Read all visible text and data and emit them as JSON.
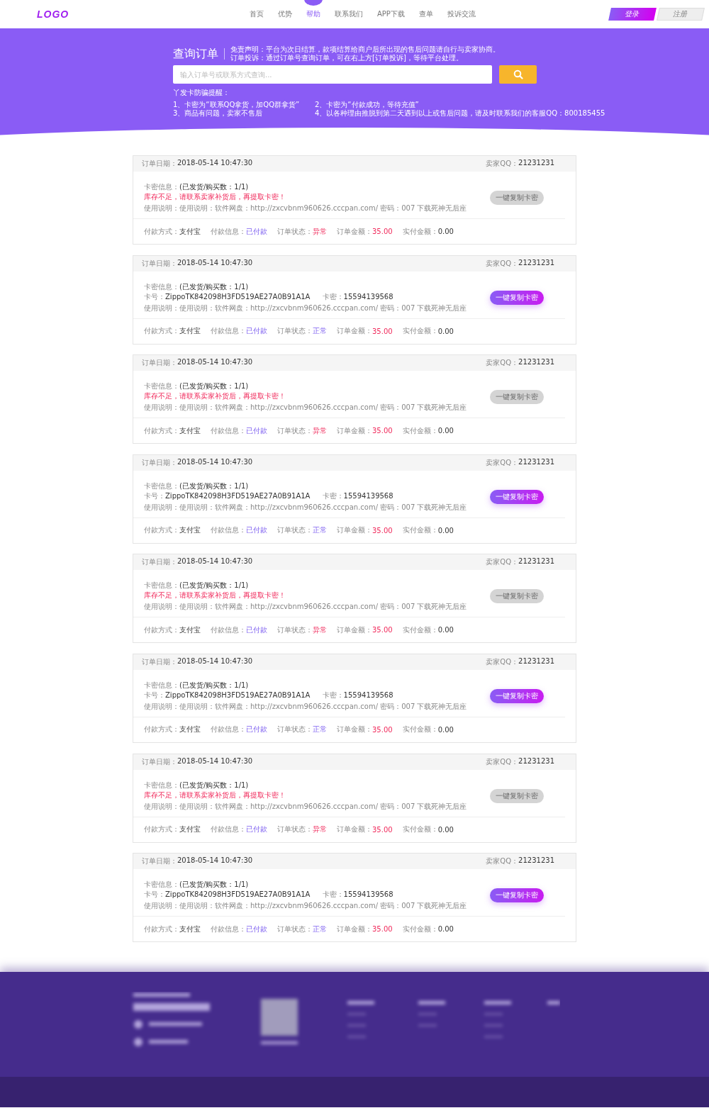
{
  "header": {
    "logo": "LOGO",
    "nav": [
      {
        "label": "首页",
        "selected": false
      },
      {
        "label": "优势",
        "selected": false
      },
      {
        "label": "帮助",
        "selected": true
      },
      {
        "label": "联系我们",
        "selected": false
      },
      {
        "label": "APP下载",
        "selected": false
      },
      {
        "label": "查单",
        "selected": false
      },
      {
        "label": "投诉交流",
        "selected": false
      }
    ],
    "login": "登录",
    "register": "注册"
  },
  "search": {
    "title": "查询订单",
    "notes": [
      "免责声明：平台为次日结算，款项结算给商户后所出现的售后问题请自行与卖家协商。",
      "订单投诉：通过订单号查询订单，可在右上方[订单投诉]，等待平台处理。"
    ],
    "placeholder": "输入订单号或联系方式查询...",
    "warning_title": "丫发卡防骗提醒：",
    "tips": [
      "1、卡密为“联系QQ拿货，加QQ群拿货”",
      "2、卡密为“付款成功，等待充值”",
      "3、商品有问题，卖家不售后",
      "4、以各种理由推脱到第二天遇到以上或售后问题，请及时联系我们的客服QQ：800185455"
    ]
  },
  "orders": [
    {
      "kind": "out_of_stock",
      "date_label": "订单日期：",
      "date": "2018-05-14 10:47:30",
      "qq_label": "卖家QQ：",
      "qq": "21231231",
      "info_label": "卡密信息：",
      "info": "(已发货/购买数：1/1)",
      "message": "库存不足，请联系卖家补货后，再提取卡密！",
      "usage_label": "使用说明：",
      "usage": "使用说明：软件网盘：http://zxcvbnm960626.cccpan.com/ 密码：007 下载死神无后座",
      "copy": {
        "label": "一键复制卡密",
        "disabled": true
      },
      "pay_label": "付款方式：",
      "pay": "支付宝",
      "payinfo_label": "付款信息：",
      "payinfo": "已付款",
      "status_label": "订单状态：",
      "status": "异常",
      "status_ok": false,
      "amount_label": "订单金额：",
      "amount": "35.00",
      "paid_label": "实付金额：",
      "paid": "0.00"
    },
    {
      "kind": "delivered",
      "date_label": "订单日期：",
      "date": "2018-05-14 10:47:30",
      "qq_label": "卖家QQ：",
      "qq": "21231231",
      "info_label": "卡密信息：",
      "info": "(已发货/购买数：1/1)",
      "card_no_label": "卡号：",
      "card_no": "ZippoTK842098H3FD519AE27A0B91A1A",
      "card_pw_label": "卡密：",
      "card_pw": "15594139568",
      "usage_label": "使用说明：",
      "usage": "使用说明：软件网盘：http://zxcvbnm960626.cccpan.com/ 密码：007 下载死神无后座",
      "copy": {
        "label": "一键复制卡密",
        "disabled": false
      },
      "pay_label": "付款方式：",
      "pay": "支付宝",
      "payinfo_label": "付款信息：",
      "payinfo": "已付款",
      "status_label": "订单状态：",
      "status": "正常",
      "status_ok": true,
      "amount_label": "订单金额：",
      "amount": "35.00",
      "paid_label": "实付金额：",
      "paid": "0.00"
    },
    {
      "kind": "out_of_stock",
      "date_label": "订单日期：",
      "date": "2018-05-14 10:47:30",
      "qq_label": "卖家QQ：",
      "qq": "21231231",
      "info_label": "卡密信息：",
      "info": "(已发货/购买数：1/1)",
      "message": "库存不足，请联系卖家补货后，再提取卡密！",
      "usage_label": "使用说明：",
      "usage": "使用说明：软件网盘：http://zxcvbnm960626.cccpan.com/ 密码：007 下载死神无后座",
      "copy": {
        "label": "一键复制卡密",
        "disabled": true
      },
      "pay_label": "付款方式：",
      "pay": "支付宝",
      "payinfo_label": "付款信息：",
      "payinfo": "已付款",
      "status_label": "订单状态：",
      "status": "异常",
      "status_ok": false,
      "amount_label": "订单金额：",
      "amount": "35.00",
      "paid_label": "实付金额：",
      "paid": "0.00"
    },
    {
      "kind": "delivered",
      "date_label": "订单日期：",
      "date": "2018-05-14 10:47:30",
      "qq_label": "卖家QQ：",
      "qq": "21231231",
      "info_label": "卡密信息：",
      "info": "(已发货/购买数：1/1)",
      "card_no_label": "卡号：",
      "card_no": "ZippoTK842098H3FD519AE27A0B91A1A",
      "card_pw_label": "卡密：",
      "card_pw": "15594139568",
      "usage_label": "使用说明：",
      "usage": "使用说明：软件网盘：http://zxcvbnm960626.cccpan.com/ 密码：007 下载死神无后座",
      "copy": {
        "label": "一键复制卡密",
        "disabled": false
      },
      "pay_label": "付款方式：",
      "pay": "支付宝",
      "payinfo_label": "付款信息：",
      "payinfo": "已付款",
      "status_label": "订单状态：",
      "status": "正常",
      "status_ok": true,
      "amount_label": "订单金额：",
      "amount": "35.00",
      "paid_label": "实付金额：",
      "paid": "0.00"
    },
    {
      "kind": "out_of_stock",
      "date_label": "订单日期：",
      "date": "2018-05-14 10:47:30",
      "qq_label": "卖家QQ：",
      "qq": "21231231",
      "info_label": "卡密信息：",
      "info": "(已发货/购买数：1/1)",
      "message": "库存不足，请联系卖家补货后，再提取卡密！",
      "usage_label": "使用说明：",
      "usage": "使用说明：软件网盘：http://zxcvbnm960626.cccpan.com/ 密码：007 下载死神无后座",
      "copy": {
        "label": "一键复制卡密",
        "disabled": true
      },
      "pay_label": "付款方式：",
      "pay": "支付宝",
      "payinfo_label": "付款信息：",
      "payinfo": "已付款",
      "status_label": "订单状态：",
      "status": "异常",
      "status_ok": false,
      "amount_label": "订单金额：",
      "amount": "35.00",
      "paid_label": "实付金额：",
      "paid": "0.00"
    },
    {
      "kind": "delivered",
      "date_label": "订单日期：",
      "date": "2018-05-14 10:47:30",
      "qq_label": "卖家QQ：",
      "qq": "21231231",
      "info_label": "卡密信息：",
      "info": "(已发货/购买数：1/1)",
      "card_no_label": "卡号：",
      "card_no": "ZippoTK842098H3FD519AE27A0B91A1A",
      "card_pw_label": "卡密：",
      "card_pw": "15594139568",
      "usage_label": "使用说明：",
      "usage": "使用说明：软件网盘：http://zxcvbnm960626.cccpan.com/ 密码：007 下载死神无后座",
      "copy": {
        "label": "一键复制卡密",
        "disabled": false
      },
      "pay_label": "付款方式：",
      "pay": "支付宝",
      "payinfo_label": "付款信息：",
      "payinfo": "已付款",
      "status_label": "订单状态：",
      "status": "正常",
      "status_ok": true,
      "amount_label": "订单金额：",
      "amount": "35.00",
      "paid_label": "实付金额：",
      "paid": "0.00"
    },
    {
      "kind": "out_of_stock",
      "date_label": "订单日期：",
      "date": "2018-05-14 10:47:30",
      "qq_label": "卖家QQ：",
      "qq": "21231231",
      "info_label": "卡密信息：",
      "info": "(已发货/购买数：1/1)",
      "message": "库存不足，请联系卖家补货后，再提取卡密！",
      "usage_label": "使用说明：",
      "usage": "使用说明：软件网盘：http://zxcvbnm960626.cccpan.com/ 密码：007 下载死神无后座",
      "copy": {
        "label": "一键复制卡密",
        "disabled": true
      },
      "pay_label": "付款方式：",
      "pay": "支付宝",
      "payinfo_label": "付款信息：",
      "payinfo": "已付款",
      "status_label": "订单状态：",
      "status": "异常",
      "status_ok": false,
      "amount_label": "订单金额：",
      "amount": "35.00",
      "paid_label": "实付金额：",
      "paid": "0.00"
    },
    {
      "kind": "delivered",
      "date_label": "订单日期：",
      "date": "2018-05-14 10:47:30",
      "qq_label": "卖家QQ：",
      "qq": "21231231",
      "info_label": "卡密信息：",
      "info": "(已发货/购买数：1/1)",
      "card_no_label": "卡号：",
      "card_no": "ZippoTK842098H3FD519AE27A0B91A1A",
      "card_pw_label": "卡密：",
      "card_pw": "15594139568",
      "usage_label": "使用说明：",
      "usage": "使用说明：软件网盘：http://zxcvbnm960626.cccpan.com/ 密码：007 下载死神无后座",
      "copy": {
        "label": "一键复制卡密",
        "disabled": false
      },
      "pay_label": "付款方式：",
      "pay": "支付宝",
      "payinfo_label": "付款信息：",
      "payinfo": "已付款",
      "status_label": "订单状态：",
      "status": "正常",
      "status_ok": true,
      "amount_label": "订单金额：",
      "amount": "35.00",
      "paid_label": "实付金额：",
      "paid": "0.00"
    }
  ]
}
